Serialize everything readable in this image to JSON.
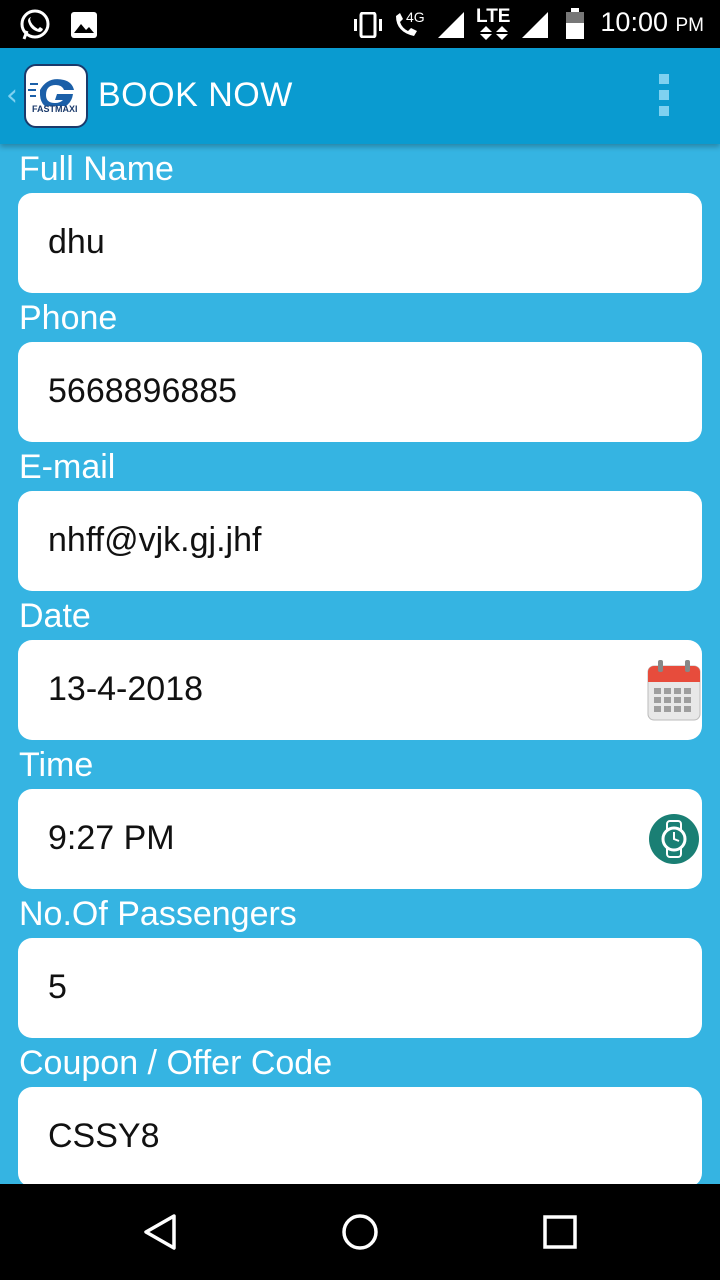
{
  "status_bar": {
    "time": "10:00",
    "ampm": "PM",
    "network_label": "4G",
    "lte_label": "LTE"
  },
  "app_bar": {
    "title": "BOOK NOW",
    "logo_text": "FASTMAXI"
  },
  "form": {
    "full_name": {
      "label": "Full Name",
      "value": "dhu"
    },
    "phone": {
      "label": "Phone",
      "value": "5668896885"
    },
    "email": {
      "label": "E-mail",
      "value": "nhff@vjk.gj.jhf"
    },
    "date": {
      "label": "Date",
      "value": "13-4-2018",
      "icon": "calendar-icon"
    },
    "time": {
      "label": "Time",
      "value": "9:27 PM",
      "icon": "watch-icon"
    },
    "passengers": {
      "label": "No.Of Passengers",
      "value": "5"
    },
    "coupon": {
      "label": "Coupon / Offer Code",
      "value": "CSSY8"
    }
  },
  "colors": {
    "background": "#35b4e2",
    "app_bar": "#0a9bd0",
    "field": "#ffffff",
    "clock_icon": "#1a7f74",
    "calendar_red": "#e74c3c"
  }
}
